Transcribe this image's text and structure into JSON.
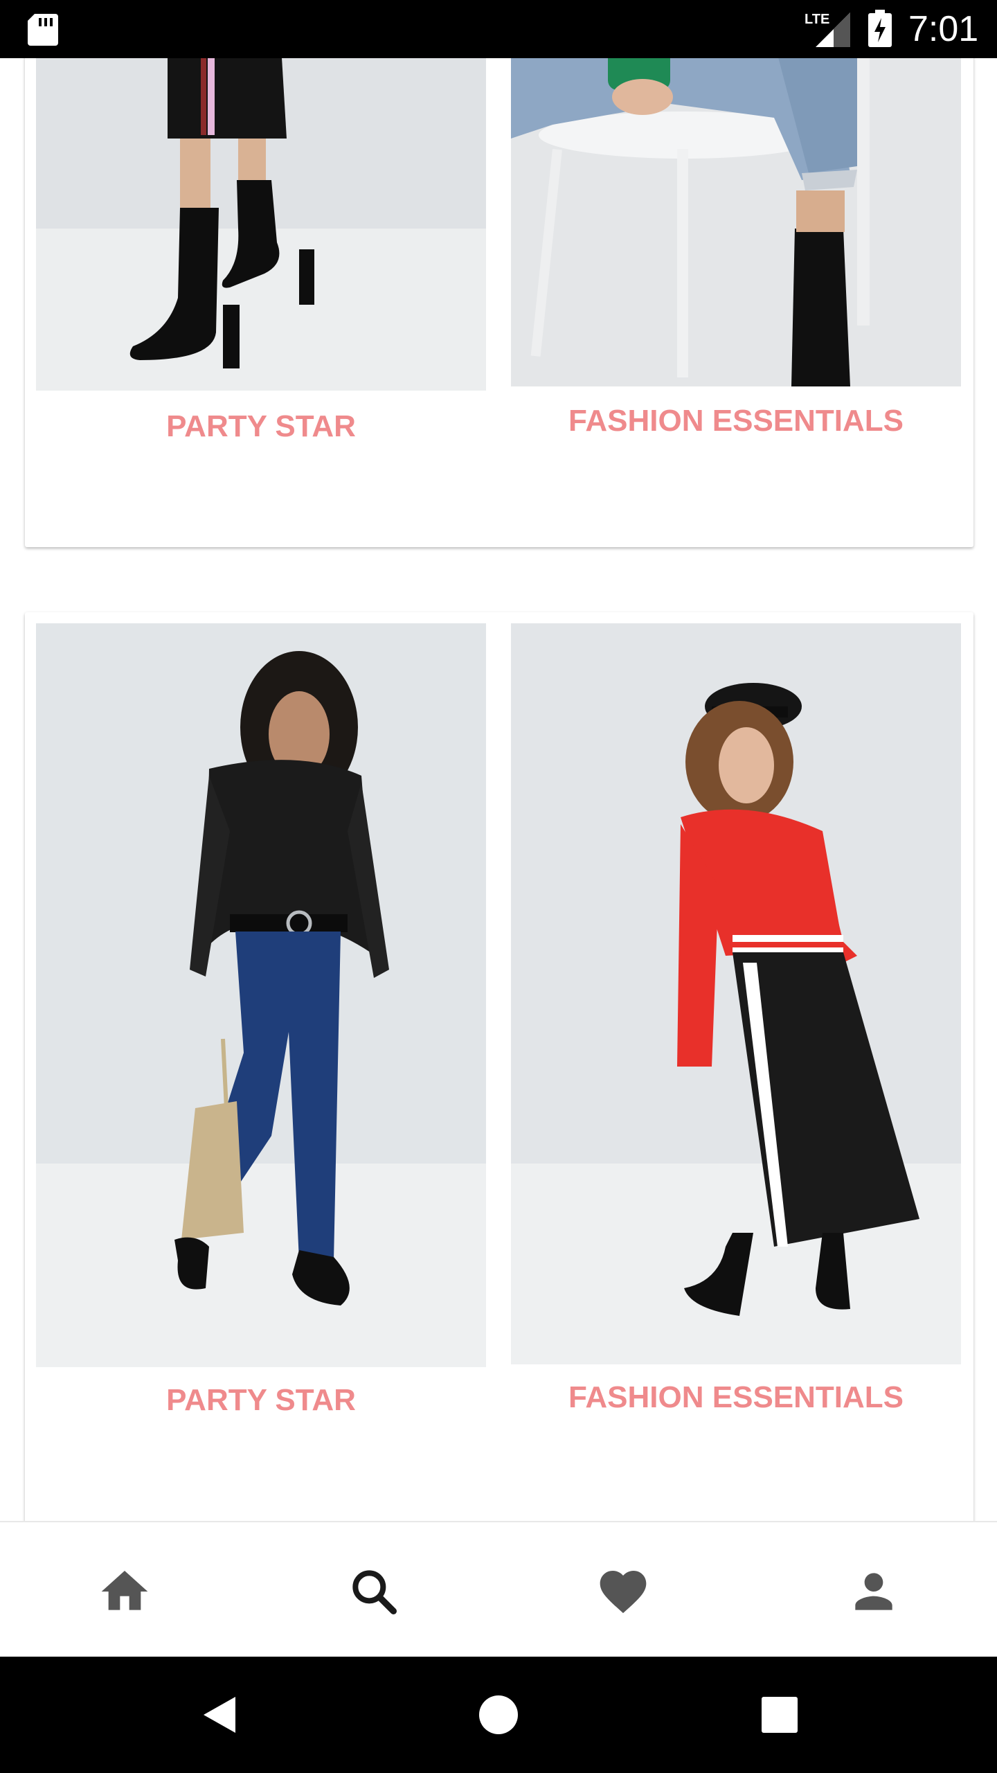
{
  "status_bar": {
    "network": "LTE",
    "time": "7:01",
    "icons": [
      "sd-card-icon",
      "lte-signal-icon",
      "battery-charging-icon"
    ]
  },
  "feed": {
    "cards": [
      {
        "tiles": [
          {
            "label": "PARTY STAR",
            "image": "black-sock-boots-photo"
          },
          {
            "label": "FASHION ESSENTIALS",
            "image": "ripped-jeans-on-stool-photo"
          }
        ]
      },
      {
        "tiles": [
          {
            "label": "PARTY STAR",
            "image": "sheer-black-blouse-and-jeans-photo"
          },
          {
            "label": "FASHION ESSENTIALS",
            "image": "red-sweater-pleated-skirt-photo"
          }
        ]
      }
    ]
  },
  "bottom_nav": {
    "items": [
      {
        "icon": "home-icon"
      },
      {
        "icon": "search-icon"
      },
      {
        "icon": "heart-icon"
      },
      {
        "icon": "person-icon"
      }
    ]
  },
  "system_nav": {
    "items": [
      {
        "icon": "back-icon"
      },
      {
        "icon": "home-circle-icon"
      },
      {
        "icon": "recents-icon"
      }
    ]
  },
  "colors": {
    "accent": "#ef8a8c",
    "nav_icon": "#555555",
    "system_bar": "#000000",
    "photo_backdrop": "#e5e8eb"
  }
}
